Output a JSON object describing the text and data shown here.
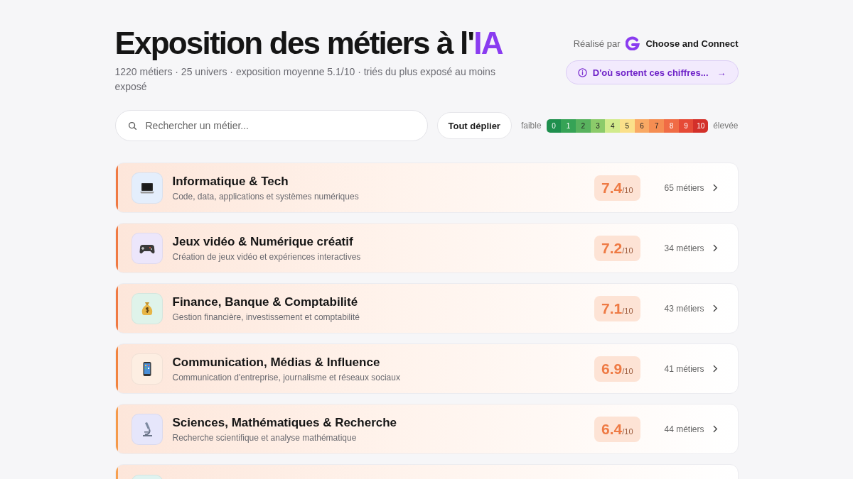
{
  "header": {
    "title": "Exposition des métiers à l'",
    "title_highlight": "IA",
    "subtitle": "1220 métiers · 25 univers · exposition moyenne 5.1/10 · triés du plus exposé au moins exposé",
    "credit_label": "Réalisé par",
    "brand": "Choose and Connect",
    "info_button": "D'où sortent ces chiffres...",
    "info_arrow": "→"
  },
  "toolbar": {
    "search": {
      "placeholder": "Rechercher un métier..."
    },
    "expand_button": "Tout déplier",
    "scale_low": "faible",
    "scale_high": "élevée",
    "scale": [
      {
        "label": "0",
        "color": "#1f8f4e"
      },
      {
        "label": "1",
        "color": "#36a356"
      },
      {
        "label": "2",
        "color": "#58b25e"
      },
      {
        "label": "3",
        "color": "#8ccb6a"
      },
      {
        "label": "4",
        "color": "#d2eb8c"
      },
      {
        "label": "5",
        "color": "#fbe08a"
      },
      {
        "label": "6",
        "color": "#f9a964"
      },
      {
        "label": "7",
        "color": "#f58d52"
      },
      {
        "label": "8",
        "color": "#f06c45"
      },
      {
        "label": "9",
        "color": "#e64a36"
      },
      {
        "label": "10",
        "color": "#d3302a"
      }
    ]
  },
  "categories": [
    {
      "kind": "laptop",
      "title": "Informatique & Tech",
      "description": "Code, data, applications et systèmes numériques",
      "score": "7.4",
      "score_suffix": "/10",
      "count": "65 métiers",
      "color": "#f07a43"
    },
    {
      "kind": "gamepad",
      "title": "Jeux vidéo & Numérique créatif",
      "description": "Création de jeux vidéo et expériences interactives",
      "score": "7.2",
      "score_suffix": "/10",
      "count": "34 métiers",
      "color": "#f07a43"
    },
    {
      "kind": "money-bag",
      "title": "Finance, Banque & Comptabilité",
      "description": "Gestion financière, investissement et comptabilité",
      "score": "7.1",
      "score_suffix": "/10",
      "count": "43 métiers",
      "color": "#f07a43"
    },
    {
      "kind": "phone",
      "title": "Communication, Médias & Influence",
      "description": "Communication d'entreprise, journalisme et réseaux sociaux",
      "score": "6.9",
      "score_suffix": "/10",
      "count": "41 métiers",
      "color": "#f2843f"
    },
    {
      "kind": "microscope",
      "title": "Sciences, Mathématiques & Recherche",
      "description": "Recherche scientifique et analyse mathématique",
      "score": "6.4",
      "score_suffix": "/10",
      "count": "44 métiers",
      "color": "#f59a4a"
    }
  ]
}
